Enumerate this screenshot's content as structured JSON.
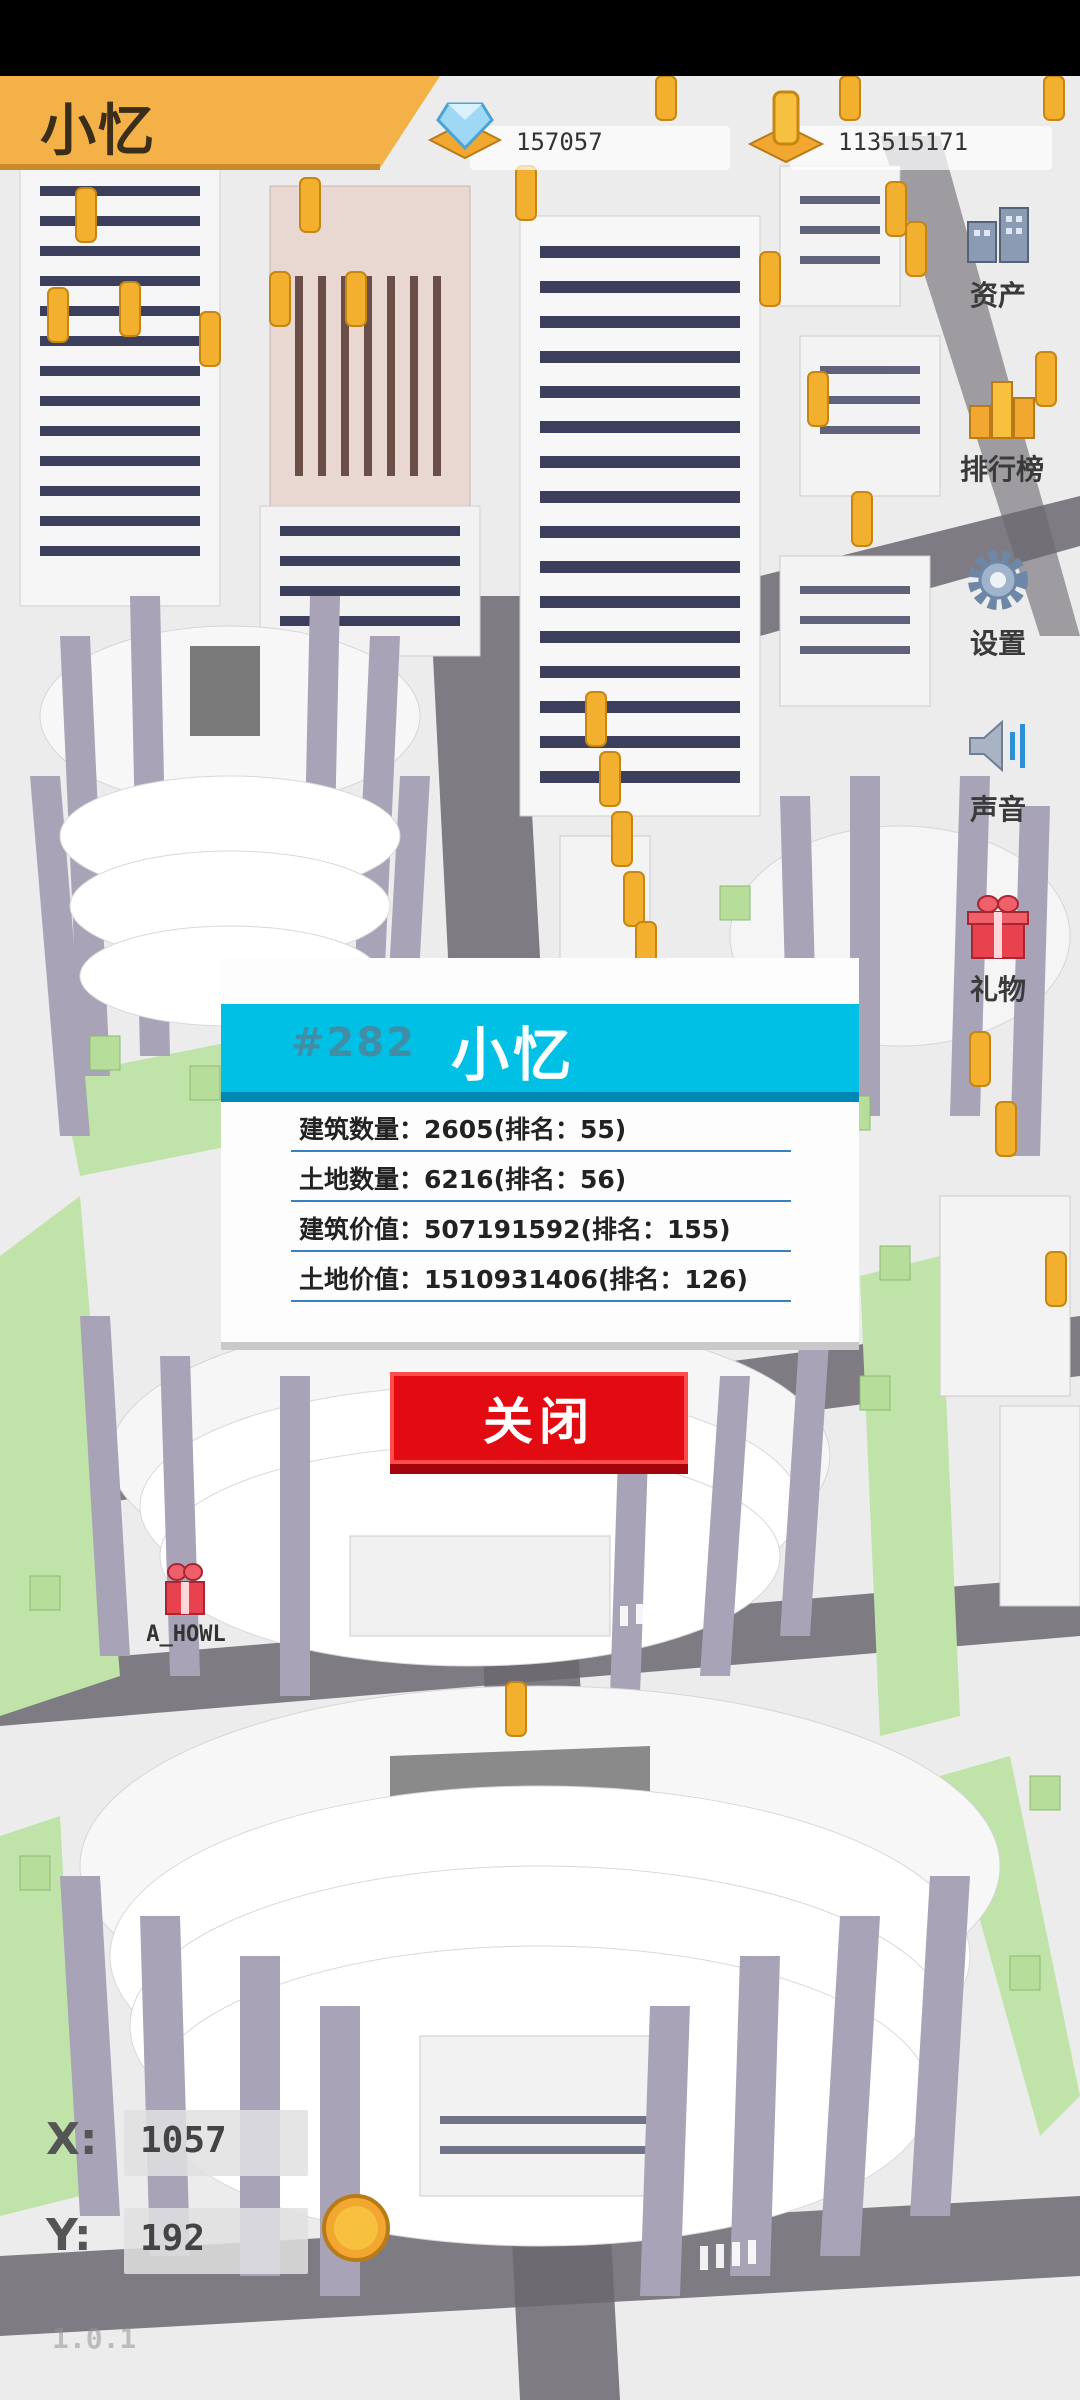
{
  "header": {
    "player_name": "小忆",
    "diamonds": "157057",
    "gold": "113515171"
  },
  "side_menu": [
    {
      "label": "资产",
      "icon": "assets-icon"
    },
    {
      "label": "排行榜",
      "icon": "leaderboard-icon"
    },
    {
      "label": "设置",
      "icon": "gear-icon"
    },
    {
      "label": "声音",
      "icon": "speaker-icon"
    },
    {
      "label": "礼物",
      "icon": "gift-icon"
    }
  ],
  "dialog": {
    "rank_number": "#282",
    "title": "小忆",
    "stats": [
      "建筑数量：2605(排名：55)",
      "土地数量：6216(排名：56)",
      "建筑价值：507191592(排名：155)",
      "土地价值：1510931406(排名：126)"
    ],
    "close_label": "关闭"
  },
  "map": {
    "other_player": "A_HOWL"
  },
  "coords": {
    "x_label": "X:",
    "x_value": "1057",
    "y_label": "Y:",
    "y_value": "192"
  },
  "version": "1.0.1",
  "colors": {
    "banner": "#f4b148",
    "dialog_header": "#00c0e6",
    "close_button": "#e20b11",
    "column": "#a9a3b8",
    "grass": "#bfe3a8",
    "coin": "#f2b02e"
  }
}
